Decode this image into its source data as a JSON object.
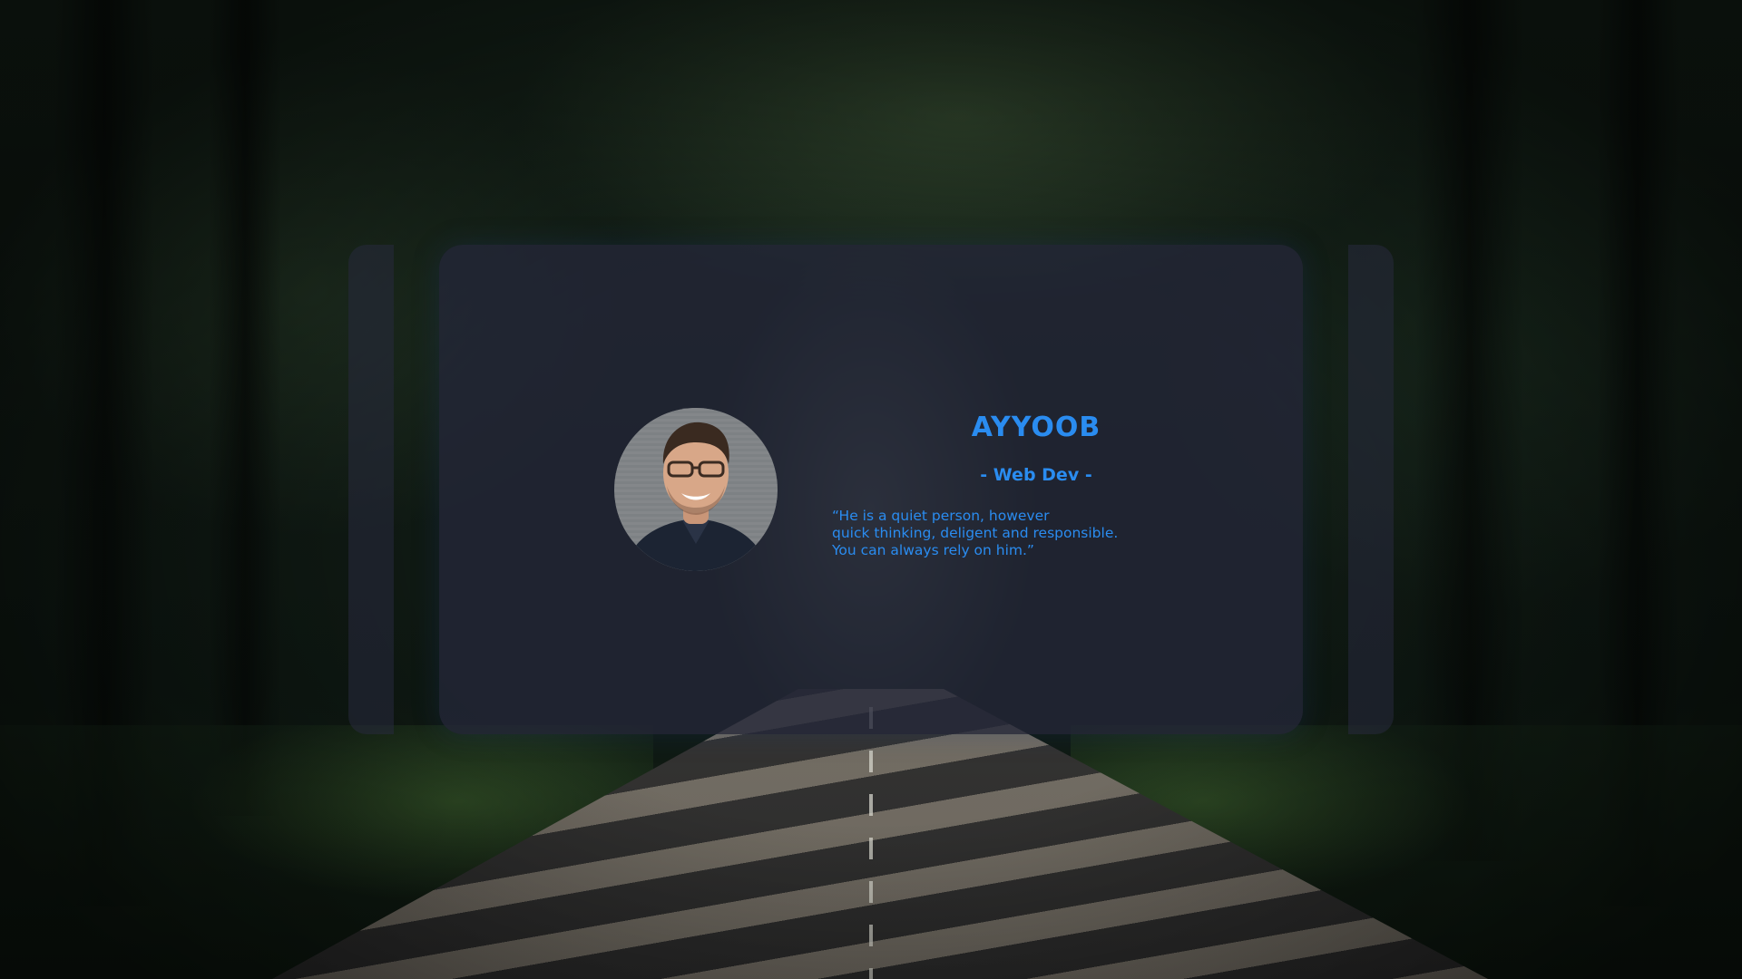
{
  "profile": {
    "name": "AYYOOB",
    "role": "- Web Dev -",
    "quote": "“He is a quiet person, however\nquick thinking, deligent and responsible.\nYou can always rely on him.”"
  },
  "colors": {
    "accent": "#2a8cf0",
    "card_background": "#24263a"
  },
  "icons": {
    "avatar": "portrait-photo"
  }
}
